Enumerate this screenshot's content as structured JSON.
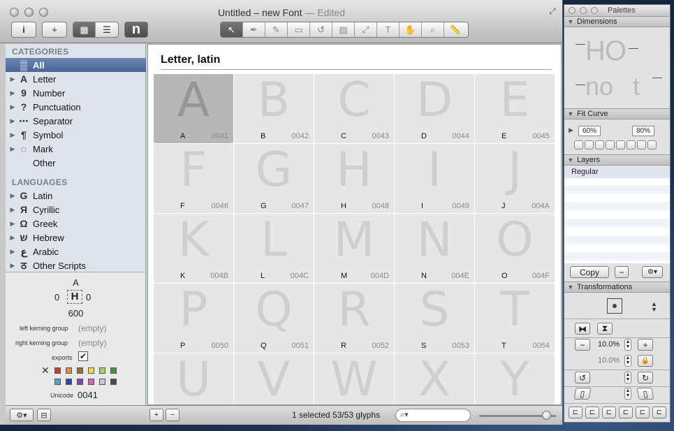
{
  "window": {
    "title": "Untitled – new Font",
    "edited": "— Edited"
  },
  "toolbar": {
    "info_icon": "i",
    "add_glyph_icon": "+",
    "grid_view_icon": "▦",
    "list_view_icon": "☰",
    "n_icon": "n",
    "tools": [
      "↖",
      "✒",
      "✎",
      "▭",
      "↺",
      "▤",
      "⤢",
      "T",
      "✋",
      "⌕",
      "📏"
    ]
  },
  "sidebar": {
    "categories_header": "CATEGORIES",
    "categories": [
      {
        "label": "All",
        "glyph": "▒",
        "expandable": false,
        "selected": true
      },
      {
        "label": "Letter",
        "glyph": "A",
        "expandable": true
      },
      {
        "label": "Number",
        "glyph": "9",
        "expandable": true
      },
      {
        "label": "Punctuation",
        "glyph": "?",
        "expandable": true
      },
      {
        "label": "Separator",
        "glyph": "⋯",
        "expandable": true
      },
      {
        "label": "Symbol",
        "glyph": "¶",
        "expandable": true
      },
      {
        "label": "Mark",
        "glyph": "◌",
        "expandable": true
      },
      {
        "label": "Other",
        "glyph": "",
        "expandable": false
      }
    ],
    "languages_header": "LANGUAGES",
    "languages": [
      {
        "label": "Latin",
        "glyph": "G"
      },
      {
        "label": "Cyrillic",
        "glyph": "Я"
      },
      {
        "label": "Greek",
        "glyph": "Ω"
      },
      {
        "label": "Hebrew",
        "glyph": "ש"
      },
      {
        "label": "Arabic",
        "glyph": "ع"
      },
      {
        "label": "Other Scripts",
        "glyph": "ठ"
      }
    ]
  },
  "info": {
    "glyph_name": "A",
    "lsb": "0",
    "rsb": "0",
    "width": "600",
    "left_kerning_label": "left kerning group",
    "left_kerning_value": "(empty)",
    "right_kerning_label": "right kerning group",
    "right_kerning_value": "(empty)",
    "exports_label": "exports",
    "unicode_label": "Unicode",
    "unicode_value": "0041",
    "colors": [
      "#d23b2f",
      "#ef8a2b",
      "#9c6d3a",
      "#f2e21f",
      "#a8d94a",
      "#3a9d3a",
      "#4aa3df",
      "#2a47b8",
      "#8a3fbf",
      "#e25fb5",
      "#c8c8c8",
      "#4a4a4a"
    ]
  },
  "main": {
    "section_title": "Letter, latin",
    "glyphs": [
      {
        "char": "A",
        "code": "0041",
        "selected": true
      },
      {
        "char": "B",
        "code": "0042"
      },
      {
        "char": "C",
        "code": "0043"
      },
      {
        "char": "D",
        "code": "0044"
      },
      {
        "char": "E",
        "code": "0045"
      },
      {
        "char": "F",
        "code": "0046"
      },
      {
        "char": "G",
        "code": "0047"
      },
      {
        "char": "H",
        "code": "0048"
      },
      {
        "char": "I",
        "code": "0049"
      },
      {
        "char": "J",
        "code": "004A"
      },
      {
        "char": "K",
        "code": "004B"
      },
      {
        "char": "L",
        "code": "004C"
      },
      {
        "char": "M",
        "code": "004D"
      },
      {
        "char": "N",
        "code": "004E"
      },
      {
        "char": "O",
        "code": "004F"
      },
      {
        "char": "P",
        "code": "0050"
      },
      {
        "char": "Q",
        "code": "0051"
      },
      {
        "char": "R",
        "code": "0052"
      },
      {
        "char": "S",
        "code": "0053"
      },
      {
        "char": "T",
        "code": "0054"
      },
      {
        "char": "U",
        "code": ""
      },
      {
        "char": "V",
        "code": ""
      },
      {
        "char": "W",
        "code": ""
      },
      {
        "char": "X",
        "code": ""
      },
      {
        "char": "Y",
        "code": ""
      }
    ]
  },
  "statusbar": {
    "status": "1 selected 53/53 glyphs",
    "gear_icon": "⚙▾",
    "tag_icon": "⊟",
    "add_icon": "+",
    "remove_icon": "−",
    "search_icon": "⌕▾",
    "zoom_fraction": 0.88
  },
  "palettes": {
    "title": "Palettes",
    "dimensions": {
      "header": "Dimensions",
      "preview_top": "HO",
      "preview_bottom": "no t"
    },
    "fit_curve": {
      "header": "Fit Curve",
      "value1": "60%",
      "value2": "80%"
    },
    "layers": {
      "header": "Layers",
      "items": [
        "Regular"
      ],
      "copy_label": "Copy",
      "remove_icon": "−",
      "gear_icon": "⚙▾"
    },
    "transformations": {
      "header": "Transformations",
      "scale_value": "10.0%",
      "scale_value2": "10.0%",
      "minus_icon": "−",
      "plus_icon": "+",
      "lock_icon": "🔒",
      "mirror_h_icon": "⧓",
      "mirror_v_icon": "⧗",
      "rotate_ccw_icon": "↺",
      "rotate_cw_icon": "↻",
      "slant_left_icon": "▯",
      "slant_right_icon": "▯"
    }
  }
}
